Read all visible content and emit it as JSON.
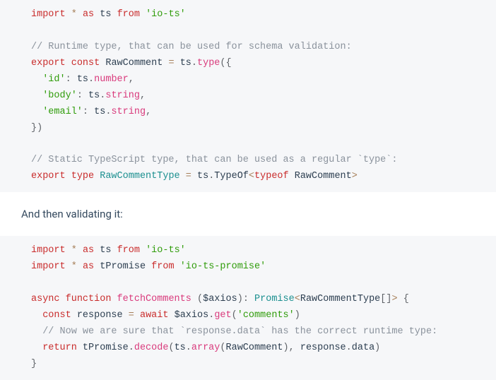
{
  "block1": {
    "l1": {
      "a": "import",
      "b": "*",
      "c": "as",
      "d": "ts",
      "e": "from",
      "f": "'io-ts'"
    },
    "l3": {
      "a": "// Runtime type, that can be used for schema validation:"
    },
    "l4": {
      "a": "export",
      "b": "const",
      "c": "RawComment",
      "d": "=",
      "e": "ts",
      "f": ".",
      "g": "type",
      "h": "(",
      "i": "{"
    },
    "l5": {
      "a": "'id'",
      "b": ":",
      "c": "ts",
      "d": ".",
      "e": "number",
      "f": ","
    },
    "l6": {
      "a": "'body'",
      "b": ":",
      "c": "ts",
      "d": ".",
      "e": "string",
      "f": ","
    },
    "l7": {
      "a": "'email'",
      "b": ":",
      "c": "ts",
      "d": ".",
      "e": "string",
      "f": ","
    },
    "l8": {
      "a": "}",
      "b": ")"
    },
    "l10": {
      "a": "// Static TypeScript type, that can be used as a regular `type`:"
    },
    "l11": {
      "a": "export",
      "b": "type",
      "c": "RawCommentType",
      "d": "=",
      "e": "ts",
      "f": ".",
      "g": "TypeOf",
      "h": "<",
      "i": "typeof",
      "j": "RawComment",
      "k": ">"
    }
  },
  "prose1": "And then validating it:",
  "block2": {
    "l1": {
      "a": "import",
      "b": "*",
      "c": "as",
      "d": "ts",
      "e": "from",
      "f": "'io-ts'"
    },
    "l2": {
      "a": "import",
      "b": "*",
      "c": "as",
      "d": "tPromise",
      "e": "from",
      "f": "'io-ts-promise'"
    },
    "l4": {
      "a": "async",
      "b": "function",
      "c": "fetchComments",
      "d": "(",
      "e": "$axios",
      "f": ")",
      "g": ":",
      "h": "Promise",
      "i": "<",
      "j": "RawCommentType",
      "k": "[",
      "l": "]",
      "m": ">",
      "n": "{"
    },
    "l5": {
      "a": "const",
      "b": "response",
      "c": "=",
      "d": "await",
      "e": "$axios",
      "f": ".",
      "g": "get",
      "h": "(",
      "i": "'comments'",
      "j": ")"
    },
    "l6": {
      "a": "// Now we are sure that `response.data` has the correct runtime type:"
    },
    "l7": {
      "a": "return",
      "b": "tPromise",
      "c": ".",
      "d": "decode",
      "e": "(",
      "f": "ts",
      "g": ".",
      "h": "array",
      "i": "(",
      "j": "RawComment",
      "k": ")",
      "l": ",",
      "m": "response",
      "n": ".",
      "o": "data",
      "p": ")"
    },
    "l8": {
      "a": "}"
    }
  }
}
